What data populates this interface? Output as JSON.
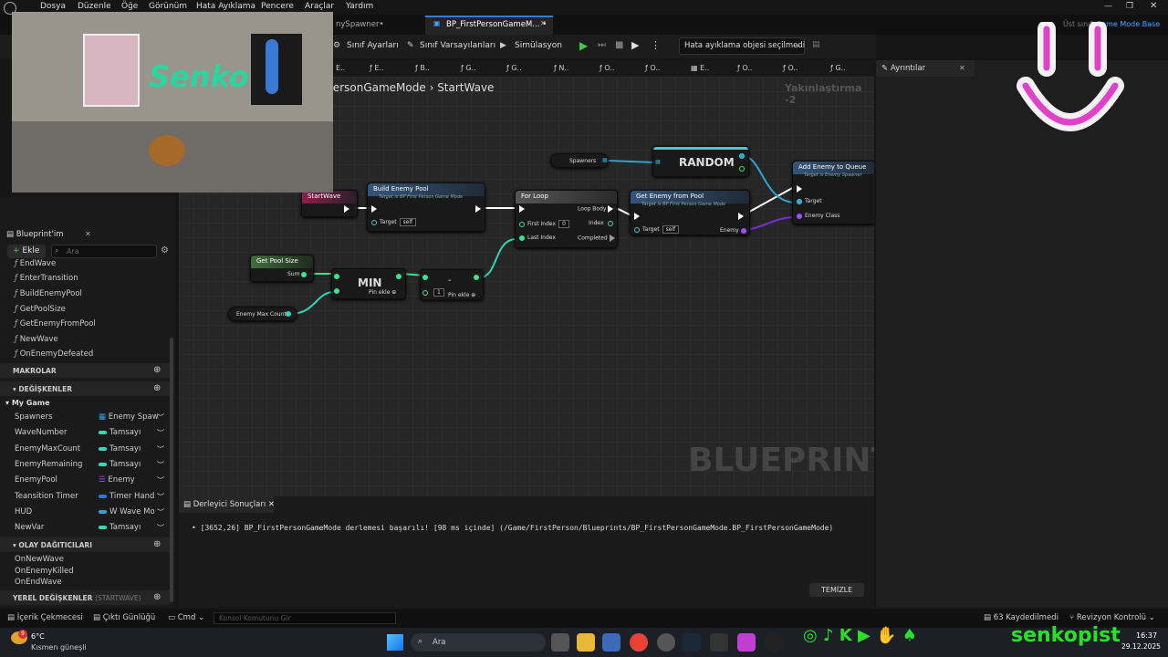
{
  "menu": [
    "Dosya",
    "Düzenle",
    "Öğe",
    "Görünüm",
    "Hata Ayıklama",
    "Pencere",
    "Araçlar",
    "Yardım"
  ],
  "tabs": {
    "tab1": "nySpawner•",
    "tab2": "BP_FirstPersonGameM... •",
    "parent_label": "Üst sınıf:",
    "parent_value": "Game Mode Base"
  },
  "toolbar": {
    "class_settings": "Sınıf Ayarları",
    "class_defaults": "Sınıf Varsayılanları",
    "simulation": "Simülasyon",
    "debug_select": "Hata ayıklama objesi seçilmedi"
  },
  "fnbar": [
    "E..",
    "E..",
    "B..",
    "G..",
    "G..",
    "N..",
    "O..",
    "O..",
    "E..",
    "O..",
    "O..",
    "G.."
  ],
  "breadcrumb": {
    "root": "PersonGameMode",
    "current": "StartWave",
    "zoom": "Yakınlaştırma -2"
  },
  "watermark": "BLUEPRINT",
  "nodes": {
    "startwave": "StartWave",
    "build": "Build Enemy Pool",
    "build_sub": "Target is BP First Person Game Mode",
    "target": "Target",
    "self": "self",
    "forloop": "For Loop",
    "first_index": "First Index",
    "first_index_val": "0",
    "last_index": "Last Index",
    "loop_body": "Loop Body",
    "index": "Index",
    "completed": "Completed",
    "get_enemy": "Get Enemy from Pool",
    "get_enemy_sub": "Target is BP First Person Game Mode",
    "enemy": "Enemy",
    "spawners": "Spawners",
    "random": "RANDOM",
    "add_enemy": "Add Enemy to Queue",
    "add_enemy_sub": "Target is Enemy Spawner",
    "enemy_class": "Enemy Class",
    "get_pool": "Get Pool Size",
    "sum": "Sum",
    "min": "MIN",
    "pin_add": "Pin ekle",
    "minus": "-",
    "minus_val": "1",
    "max_count": "Enemy Max Count"
  },
  "left": {
    "title": "Blueprint'im",
    "add": "Ekle",
    "search_placeholder": "Ara",
    "functions": [
      "EndWave",
      "EnterTransition",
      "BuildEnemyPool",
      "GetPoolSize",
      "GetEnemyFromPool",
      "NewWave",
      "OnEnemyDefeated"
    ],
    "macros": "MAKROLAR",
    "variables": "DEĞİŞKENLER",
    "my_game": "My Game",
    "vars": [
      {
        "name": "Spawners",
        "type": "Enemy Spaw"
      },
      {
        "name": "WaveNumber",
        "type": "Tamsayı"
      },
      {
        "name": "EnemyMaxCount",
        "type": "Tamsayı"
      },
      {
        "name": "EnemyRemaining",
        "type": "Tamsayı"
      },
      {
        "name": "EnemyPool",
        "type": "Enemy"
      },
      {
        "name": "Teansition Timer",
        "type": "Timer Hand"
      },
      {
        "name": "HUD",
        "type": "W Wave Mo"
      },
      {
        "name": "NewVar",
        "type": "Tamsayı"
      }
    ],
    "dispatchers": "OLAY DAĞITICILARI",
    "events": [
      "OnNewWave",
      "OnEnemyKilled",
      "OnEndWave"
    ],
    "local_vars": "YEREL DEĞİŞKENLER",
    "local_vars_hint": "(STARTWAVE)"
  },
  "details": {
    "title": "Ayrıntılar"
  },
  "compiler": {
    "title": "Derleyici Sonuçları",
    "message": "[3652,26] BP_FirstPersonGameMode derlemesi başarılı! [98 ms içinde] (/Game/FirstPerson/Blueprints/BP_FirstPersonGameMode.BP_FirstPersonGameMode)",
    "clear": "TEMİZLE"
  },
  "status": {
    "content": "İçerik Çekmecesi",
    "output": "Çıktı Günlüğü",
    "cmd": "Cmd",
    "console_placeholder": "Konsol Komutunu Gir",
    "saved": "63 Kaydedilmedi",
    "revision": "Revizyon Kontrolü"
  },
  "taskbar": {
    "temp": "6°C",
    "weather": "Kısmen güneşli",
    "search": "Ara",
    "brand": "senkopist",
    "time": "16:37",
    "date": "29.12.2025",
    "badge": "9"
  },
  "webcam": {
    "wall_text": "Senko"
  }
}
